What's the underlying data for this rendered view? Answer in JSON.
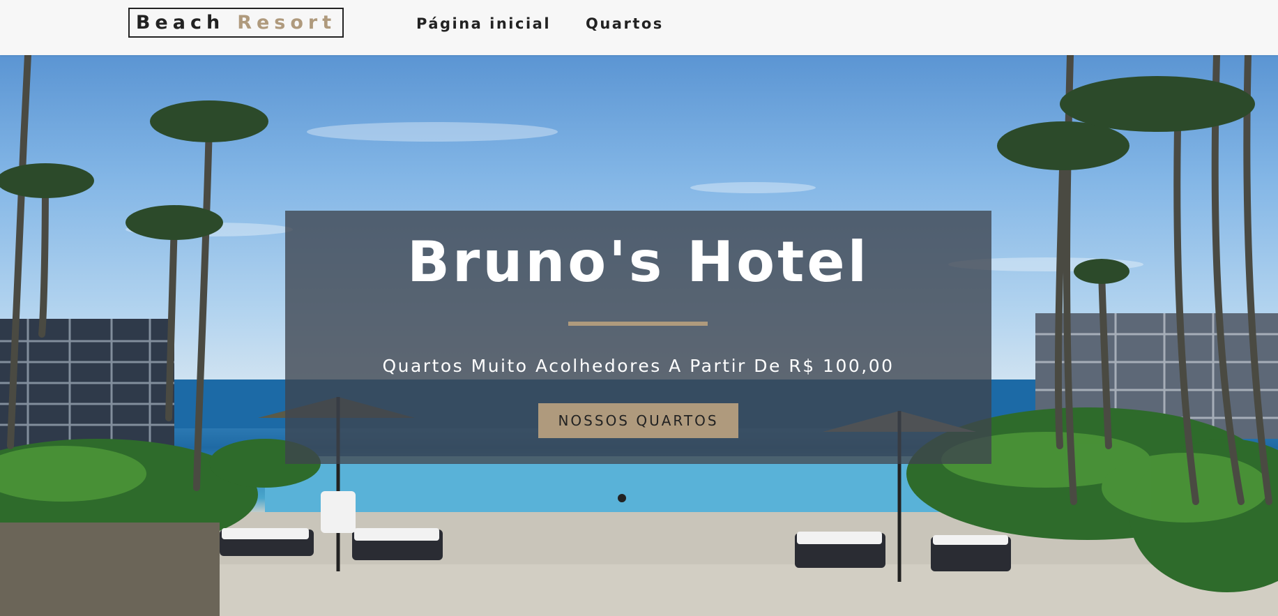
{
  "navbar": {
    "logo": {
      "word1": "Beach",
      "word2": "Resort"
    },
    "links": [
      {
        "label": "Página inicial"
      },
      {
        "label": "Quartos"
      }
    ]
  },
  "hero": {
    "title": "Bruno's Hotel",
    "subtitle": "Quartos Muito Acolhedores A Partir De R$ 100,00",
    "button_label": "NOSSOS QUARTOS"
  },
  "colors": {
    "accent": "#af9a7d",
    "text_dark": "#222222",
    "navbar_bg": "#f7f7f7",
    "banner_overlay": "rgba(62,68,78,0.78)"
  }
}
